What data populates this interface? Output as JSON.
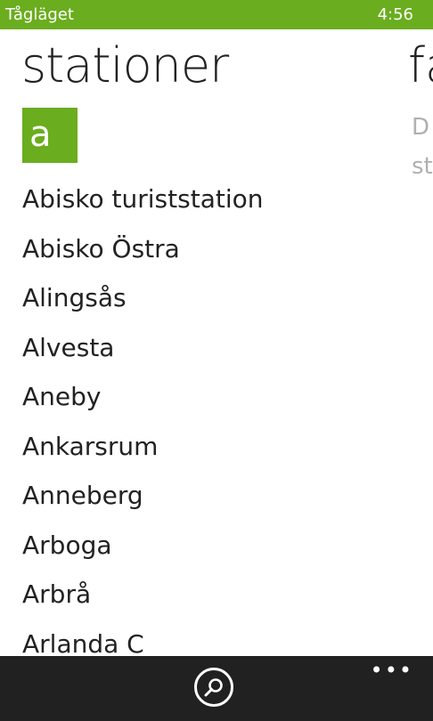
{
  "status_bar": {
    "app_name": "Tågläget",
    "time": "4:56"
  },
  "pivot": {
    "title": "stationer",
    "next_title_peek": "fa"
  },
  "peek_content": {
    "line1": "D",
    "line2": "st"
  },
  "group": {
    "letter": "a"
  },
  "stations": [
    "Abisko turiststation",
    "Abisko Östra",
    "Alingsås",
    "Alvesta",
    "Aneby",
    "Ankarsrum",
    "Anneberg",
    "Arboga",
    "Arbrå",
    "Arlanda C"
  ],
  "app_bar": {
    "search_icon": "search-icon",
    "more_label": "•••"
  },
  "colors": {
    "accent": "#6aad1e",
    "app_bar_bg": "#212121",
    "text": "#222222",
    "peek_text": "#b0b0b0"
  }
}
